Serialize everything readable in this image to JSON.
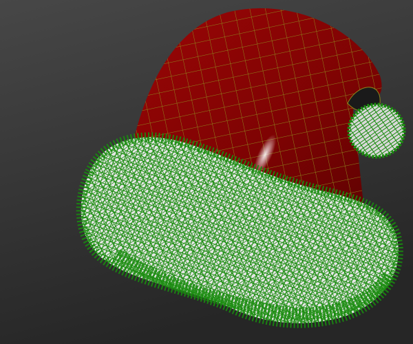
{
  "scene": {
    "object": "santa-hat",
    "view_mode": "shaded-with-wireframe"
  },
  "colors": {
    "background_top": "#474747",
    "background_bottom": "#262626",
    "hat_red": "#8a0505",
    "wire_grid": "#8a8a1a",
    "fur_green": "#1a8c0f",
    "fur_white": "#e8e8e8"
  }
}
